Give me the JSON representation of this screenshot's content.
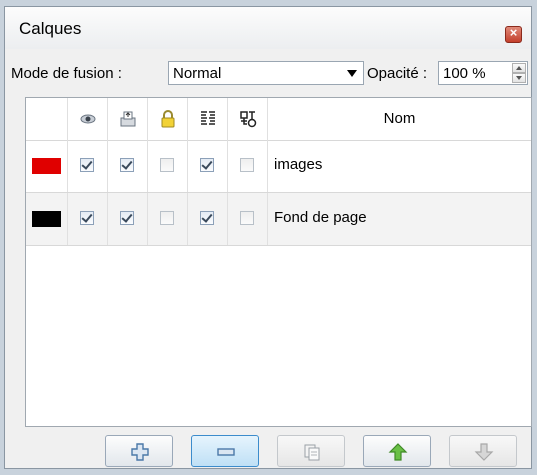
{
  "window": {
    "title": "Calques"
  },
  "toolbar": {
    "blend_label": "Mode de fusion :",
    "blend_value": "Normal",
    "opacity_label": "Opacité :",
    "opacity_value": "100 %"
  },
  "table": {
    "columns": [
      {
        "icon": "color-swatch-column"
      },
      {
        "icon": "eye-icon"
      },
      {
        "icon": "print-icon"
      },
      {
        "icon": "lock-icon"
      },
      {
        "icon": "text-wrap-icon"
      },
      {
        "icon": "link-icon"
      },
      {
        "label": "Nom"
      }
    ],
    "rows": [
      {
        "color": "#e00000",
        "visible": true,
        "printable": true,
        "locked": false,
        "wrap": true,
        "linked": false,
        "name": "images"
      },
      {
        "color": "#000000",
        "visible": true,
        "printable": true,
        "locked": false,
        "wrap": true,
        "linked": false,
        "name": "Fond de page"
      }
    ]
  },
  "buttons": [
    {
      "icon": "plus-icon",
      "state": "normal"
    },
    {
      "icon": "minus-icon",
      "state": "selected"
    },
    {
      "icon": "duplicate-icon",
      "state": "disabled"
    },
    {
      "icon": "arrow-up-icon",
      "state": "normal"
    },
    {
      "icon": "arrow-down-icon",
      "state": "disabled"
    }
  ]
}
